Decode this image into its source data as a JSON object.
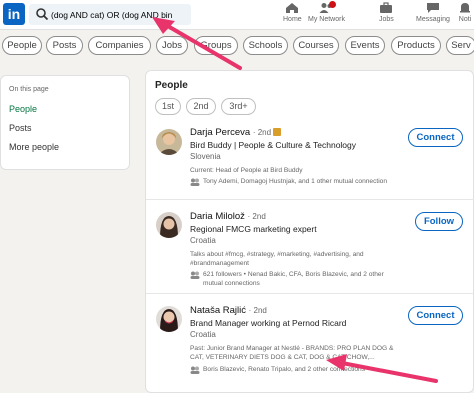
{
  "nav": {
    "logo": "in",
    "search_value": "(dog AND cat) OR (dog AND bin",
    "items": [
      {
        "label": "Home",
        "icon": "home-icon"
      },
      {
        "label": "My Network",
        "icon": "network-icon"
      },
      {
        "label": "Jobs",
        "icon": "jobs-icon"
      },
      {
        "label": "Messaging",
        "icon": "messaging-icon"
      },
      {
        "label": "Noti",
        "icon": "bell-icon"
      }
    ]
  },
  "filters": [
    "People",
    "Posts",
    "Companies",
    "Jobs",
    "Groups",
    "Schools",
    "Courses",
    "Events",
    "Products",
    "Serv"
  ],
  "left_panel": {
    "header": "On this page",
    "items": [
      "People",
      "Posts",
      "More people"
    ]
  },
  "results": {
    "title": "People",
    "pages": [
      "1st",
      "2nd",
      "3rd+"
    ],
    "people": [
      {
        "name": "Darja Perceva",
        "degree": "· 2nd",
        "headline": "Bird Buddy | People & Culture & Technology",
        "location": "Slovenia",
        "current": "Current: Head of People at Bird Buddy",
        "mutual": "Tony Ademi, Domagoj Hustnjak, and 1 other mutual connection",
        "action": "Connect"
      },
      {
        "name": "Daria Milolož",
        "degree": "· 2nd",
        "headline": "Regional FMCG marketing expert",
        "location": "Croatia",
        "current": "Talks about #fmcg, #strategy, #marketing, #advertising, and #brandmanagement",
        "mutual": "621 followers • Nenad Bakic, CFA, Boris Blazevic, and 2 other mutual connections",
        "action": "Follow"
      },
      {
        "name": "Nataša Rajlić",
        "degree": "· 2nd",
        "headline": "Brand Manager working at Pernod Ricard",
        "location": "Croatia",
        "current": "Past: Junior Brand Manager at Nestlé - BRANDS: PRO PLAN DOG & CAT, VETERINARY DIETS DOG & CAT, DOG & CAT CHOW,...",
        "mutual": "Boris Blazevic, Renato Tripalo, and 2 other connections",
        "action": "Connect"
      }
    ]
  },
  "colors": {
    "brand": "#0a66c2",
    "arrow": "#e8336b",
    "active": "#057642"
  }
}
